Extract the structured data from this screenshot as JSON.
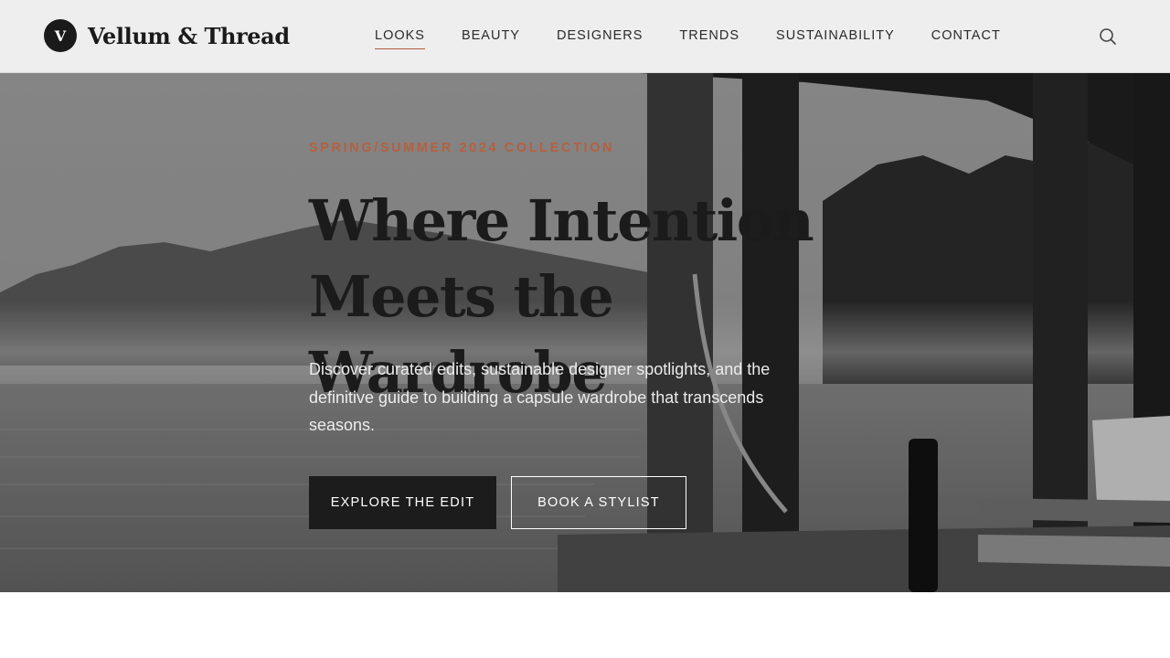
{
  "brand": {
    "logo_letter": "V",
    "name": "Vellum & Thread"
  },
  "nav": {
    "items": [
      "LOOKS",
      "BEAUTY",
      "DESIGNERS",
      "TRENDS",
      "SUSTAINABILITY",
      "CONTACT"
    ],
    "active": "LOOKS"
  },
  "header": {
    "search_icon": "search-icon"
  },
  "hero": {
    "eyebrow": "SPRING/SUMMER 2024 COLLECTION",
    "headline_line1": "Where Intention",
    "headline_line2": "Meets the Wardrobe",
    "subtext": "Discover curated edits, sustainable designer spotlights, and the definitive guide to building a capsule wardrobe that transcends seasons.",
    "primary_button": "EXPLORE THE EDIT",
    "secondary_button": "BOOK A STYLIST"
  },
  "colors": {
    "accent": "#b4603f",
    "dark": "#1c1c1c",
    "header_bg": "#f2f2f2"
  }
}
